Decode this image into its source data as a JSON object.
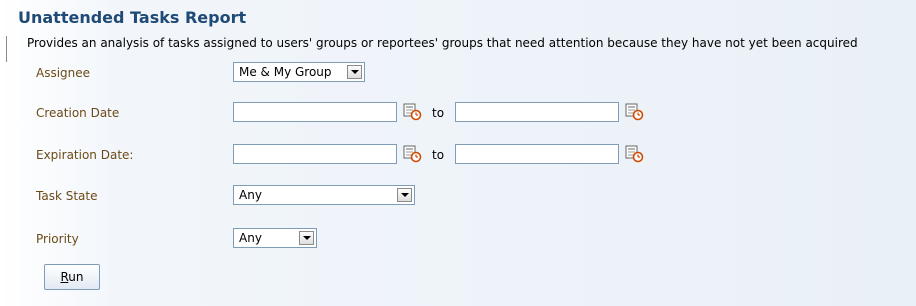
{
  "report": {
    "title": "Unattended Tasks Report",
    "description": "Provides an analysis of tasks assigned to users' groups or reportees' groups that need attention because they have not yet been acquired"
  },
  "form": {
    "assignee": {
      "label": "Assignee",
      "value": "Me & My Group"
    },
    "creation_date": {
      "label": "Creation Date",
      "from": "",
      "to": "",
      "to_label": "to"
    },
    "expiration_date": {
      "label": "Expiration Date:",
      "from": "",
      "to": "",
      "to_label": "to"
    },
    "task_state": {
      "label": "Task State",
      "value": "Any"
    },
    "priority": {
      "label": "Priority",
      "value": "Any"
    }
  },
  "run_button": {
    "mnemonic": "R",
    "rest": "un"
  },
  "icons": {
    "calendar": "calendar-icon",
    "dropdown": "chevron-down-icon"
  }
}
